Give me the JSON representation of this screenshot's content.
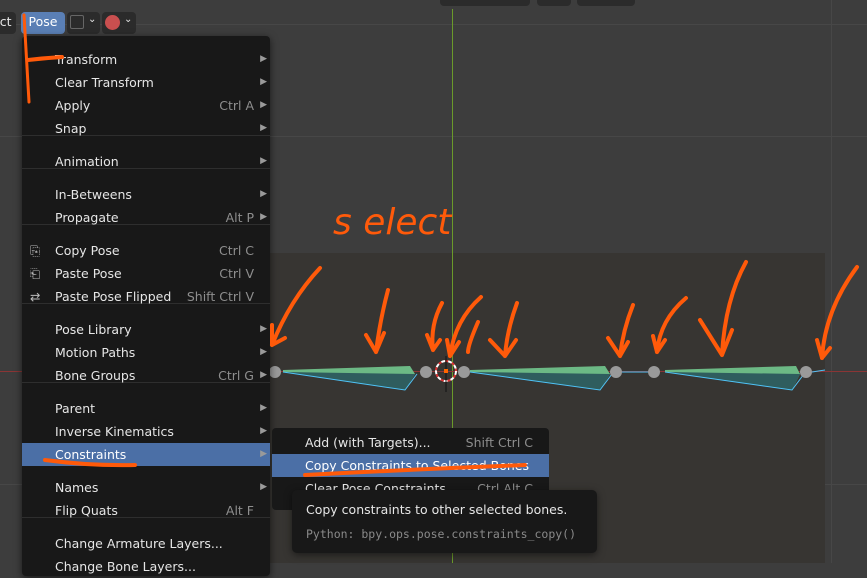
{
  "header": {
    "select_partial": "ect",
    "pose_menu": "Pose"
  },
  "menu": {
    "items": [
      {
        "label": "Transform",
        "shortcut": "",
        "submenu": true
      },
      {
        "label": "Clear Transform",
        "shortcut": "",
        "submenu": true
      },
      {
        "label": "Apply",
        "shortcut": "Ctrl A",
        "submenu": true
      },
      {
        "label": "Snap",
        "shortcut": "",
        "submenu": true
      },
      {
        "label": "Animation",
        "shortcut": "",
        "submenu": true
      },
      {
        "label": "In-Betweens",
        "shortcut": "",
        "submenu": true
      },
      {
        "label": "Propagate",
        "shortcut": "Alt P",
        "submenu": true
      },
      {
        "label": "Copy Pose",
        "shortcut": "Ctrl C",
        "icon": "copy-icon"
      },
      {
        "label": "Paste Pose",
        "shortcut": "Ctrl V",
        "icon": "paste-icon"
      },
      {
        "label": "Paste Pose Flipped",
        "shortcut": "Shift Ctrl V",
        "icon": "paste-flipped-icon"
      },
      {
        "label": "Pose Library",
        "shortcut": "",
        "submenu": true
      },
      {
        "label": "Motion Paths",
        "shortcut": "",
        "submenu": true
      },
      {
        "label": "Bone Groups",
        "shortcut": "Ctrl G",
        "submenu": true
      },
      {
        "label": "Parent",
        "shortcut": "",
        "submenu": true
      },
      {
        "label": "Inverse Kinematics",
        "shortcut": "",
        "submenu": true
      },
      {
        "label": "Constraints",
        "shortcut": "",
        "submenu": true,
        "highlighted": true
      },
      {
        "label": "Names",
        "shortcut": "",
        "submenu": true
      },
      {
        "label": "Flip Quats",
        "shortcut": "Alt F"
      },
      {
        "label": "Change Armature Layers...",
        "shortcut": ""
      },
      {
        "label": "Change Bone Layers...",
        "shortcut": ""
      }
    ]
  },
  "submenu": {
    "items": [
      {
        "label": "Add (with Targets)...",
        "shortcut": "Shift Ctrl C"
      },
      {
        "label": "Copy Constraints to Selected Bones",
        "shortcut": "",
        "highlighted": true
      },
      {
        "label": "Clear Pose Constraints",
        "shortcut": "Ctrl Alt C"
      }
    ]
  },
  "tooltip": {
    "description": "Copy constraints to other selected bones.",
    "python": "Python: bpy.ops.pose.constraints_copy()"
  },
  "annotation": {
    "text": "s elect",
    "color": "#ff5a0a"
  },
  "colors": {
    "highlight": "#4b6fa6",
    "bone_green": "#6cb985",
    "bone_outline": "#4fc3f7",
    "x_axis": "#9b3a3a",
    "y_axis": "#6a9a2a"
  }
}
